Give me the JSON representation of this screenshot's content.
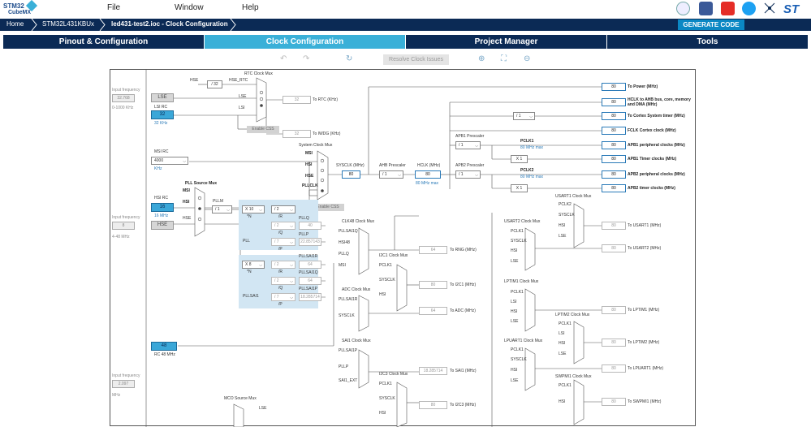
{
  "menubar": {
    "logo_line1": "STM32",
    "logo_line2": "CubeMX",
    "file": "File",
    "window": "Window",
    "help": "Help"
  },
  "breadcrumb": {
    "home": "Home",
    "device": "STM32L431KBUx",
    "project": "led431-test2.ioc - Clock Configuration"
  },
  "generate_code": "GENERATE CODE",
  "tabs": [
    "Pinout & Configuration",
    "Clock Configuration",
    "Project Manager",
    "Tools"
  ],
  "toolbar": {
    "undo": "↶",
    "redo": "↷",
    "refresh": "↻",
    "resolve": "Resolve Clock Issues",
    "zoom_in": "⊕",
    "fit": "⛶",
    "zoom_out": "⊖"
  },
  "diagram": {
    "lse_input_label": "Input frequency",
    "lse_input": "32.768",
    "lse_range": "0-1000 KHz",
    "lse": "LSE",
    "lsi_label": "LSI RC",
    "lsi": "32",
    "lsi_unit": "32 KHz",
    "msi_label": "MSI RC",
    "msi": "4000",
    "msi_unit": "KHz",
    "hsi_label": "HSI RC",
    "hsi": "16",
    "hsi_unit": "16 MHz",
    "hse": "HSE",
    "hse_input_label": "Input frequency",
    "hse_input": "8",
    "hse_range": "4-48 MHz",
    "rc48": "48",
    "rc48_label": "RC 48 MHz",
    "i2_input_label": "Input frequency",
    "i2_input": "2.097",
    "i2_unit": "MHz",
    "rtc_mux": "RTC Clock Mux",
    "hse_div": "/ 32",
    "hse_rtc": "HSE_RTC",
    "rtc_hse": "HSE",
    "rtc_lse": "LSE",
    "rtc_lsi": "LSI",
    "rtc_out": "32",
    "rtc_to": "To RTC (KHz)",
    "enable_css": "Enable CSS",
    "iwdg_out": "32",
    "iwdg_to": "To IWDG (KHz)",
    "sys_mux": "System Clock Mux",
    "sys_msi": "MSI",
    "sys_hsi": "HSI",
    "sys_hse": "HSE",
    "sys_pll": "PLLCLK",
    "sysclk_label": "SYSCLK (MHz)",
    "sysclk": "80",
    "enable_css2": "Enable CSS",
    "ahb_label": "AHB Prescaler",
    "ahb": "/ 1",
    "hclk_label": "HCLK (MHz)",
    "hclk": "80",
    "hclk_max": "80 MHz max",
    "apb1_label": "APB1 Prescaler",
    "apb1": "/ 1",
    "pclk1": "PCLK1",
    "pclk1_max": "80 MHz max",
    "apb2_label": "APB2 Prescaler",
    "apb2": "/ 1",
    "pclk2": "PCLK2",
    "pclk2_max": "80 MHz max",
    "x1a": "X 1",
    "x1b": "X 1",
    "systimer_div": "/ 1",
    "outputs": [
      {
        "v": "80",
        "t": "To Power (MHz)"
      },
      {
        "v": "80",
        "t": "HCLK to AHB bus, core, memory and DMA (MHz)"
      },
      {
        "v": "80",
        "t": "To Cortex System timer (MHz)"
      },
      {
        "v": "80",
        "t": "FCLK Cortex clock (MHz)"
      },
      {
        "v": "80",
        "t": "APB1 peripheral clocks (MHz)"
      },
      {
        "v": "80",
        "t": "APB1 Timer clocks (MHz)"
      },
      {
        "v": "80",
        "t": "APB2 peripheral clocks (MHz)"
      },
      {
        "v": "80",
        "t": "APB2 timer clocks (MHz)"
      }
    ],
    "pll_mux": "PLL Source Mux",
    "pll_msi": "MSI",
    "pll_hsi": "HSI",
    "pll_hse": "HSE",
    "pllm": "PLLM",
    "pllm_val": "/ 1",
    "plln": "X 10",
    "plln_n": "*N",
    "pllr": "/ 2",
    "pllr_r": "/R",
    "pllq": "/ 2",
    "pllq_q": "/Q",
    "pllp": "/ 7",
    "pllp_p": "/P",
    "pll": "PLL",
    "pllq_out_label": "PLLQ",
    "pllq_out": "40",
    "pllp_out_label": "PLLP",
    "pllp_out": "22.857143",
    "sai1n": "X 8",
    "sai1n_n": "*N",
    "sai1r": "/ 2",
    "sai1r_r": "/R",
    "sai1q": "/ 2",
    "sai1q_q": "/Q",
    "sai1p": "/ 7",
    "sai1p_p": "/P",
    "pllsai1": "PLLSAI1",
    "sai1r_label": "PLLSAI1R",
    "sai1r_out": "64",
    "sai1q_label": "PLLSAI1Q",
    "sai1q_out": "64",
    "sai1p_label": "PLLSAI1P",
    "sai1p_out": "18.285714",
    "clk48_mux": "CLK48 Clock Mux",
    "clk48_in": [
      "PLLSAI1Q",
      "HSI48",
      "PLLQ",
      "MSI"
    ],
    "hsi48": "HSI48",
    "rng_out": "64",
    "rng_to": "To RNG (MHz)",
    "i2c1_mux": "I2C1 Clock Mux",
    "i2c1_in": [
      "PCLK1",
      "SYSCLK",
      "HSI"
    ],
    "i2c1_out": "80",
    "i2c1_to": "To I2C1 (MHz)",
    "adc_mux": "ADC Clock Mux",
    "adc_in": [
      "PLLSAI1R",
      "SYSCLK"
    ],
    "adc_out": "64",
    "adc_to": "To ADC (MHz)",
    "sai1_mux": "SAI1 Clock Mux",
    "sai1_in": [
      "PLLSAI1P",
      "PLLP",
      "SAI1_EXT"
    ],
    "sai1_out": "18.285714",
    "sai1_to": "To SAI1 (MHz)",
    "i2c3_mux": "I2C3 Clock Mux",
    "i2c3_in": [
      "PCLK1",
      "SYSCLK",
      "HSI"
    ],
    "i2c3_out": "80",
    "i2c3_to": "To I2C3 (MHz)",
    "mco_mux": "MCO Source Mux",
    "mco_lse": "LSE",
    "usart1_mux": "USART1 Clock Mux",
    "usart1_in": [
      "PCLK2",
      "SYSCLK",
      "HSI",
      "LSE"
    ],
    "usart1_out": "80",
    "usart1_to": "To USART1 (MHz)",
    "usart2_mux": "USART2 Clock Mux",
    "usart2_in": [
      "PCLK1",
      "SYSCLK",
      "HSI",
      "LSE"
    ],
    "usart2_out": "80",
    "usart2_to": "To USART2 (MHz)",
    "lptim1_mux": "LPTIM1 Clock Mux",
    "lptim1_in": [
      "PCLK1",
      "LSI",
      "HSI",
      "LSE"
    ],
    "lptim1_out": "80",
    "lptim1_to": "To LPTIM1 (MHz)",
    "lptim2_mux": "LPTIM2 Clock Mux",
    "lptim2_in": [
      "PCLK1",
      "LSI",
      "HSI",
      "LSE"
    ],
    "lptim2_out": "80",
    "lptim2_to": "To LPTIM2 (MHz)",
    "lpuart1_mux": "LPUART1 Clock Mux",
    "lpuart1_in": [
      "PCLK1",
      "SYSCLK",
      "HSI",
      "LSE"
    ],
    "lpuart1_out": "80",
    "lpuart1_to": "To LPUART1 (MHz)",
    "swpmi1_mux": "SWPMI1 Clock Mux",
    "swpmi1_in": [
      "PCLK1",
      "HSI"
    ],
    "swpmi1_out": "80",
    "swpmi1_to": "To SWPMI1 (MHz)"
  }
}
